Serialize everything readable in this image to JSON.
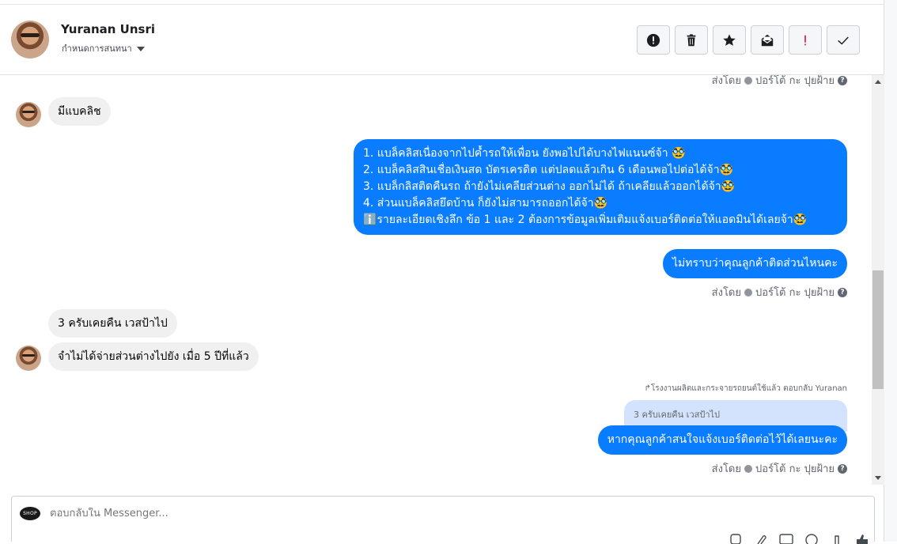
{
  "header": {
    "contact_name": "Yuranan Unsri",
    "assign_label": "กำหนดการสนทนา",
    "actions": [
      {
        "name": "follow-up-button",
        "icon": "exclamation-circle-icon"
      },
      {
        "name": "delete-button",
        "icon": "trash-icon"
      },
      {
        "name": "star-button",
        "icon": "star-icon"
      },
      {
        "name": "mark-unread-button",
        "icon": "envelope-open-icon"
      },
      {
        "name": "spam-button",
        "icon": "red-exclamation-icon"
      },
      {
        "name": "done-button",
        "icon": "check-icon"
      }
    ]
  },
  "meta": {
    "sent_by_prefix": "ส่งโดย",
    "sent_by_name": "ปอร์โต้ กะ ปุยฝ้าย",
    "help_glyph": "?"
  },
  "messages": {
    "in1": "มีแบคลิช",
    "out_long": [
      "1. แบล็คลิสเนื่องจากไปค้ำรถให้เพื่อน ยังพอไปได้บางไฟแนนซ์จ้า 🥸",
      "2. แบล็คลิสสินเชื่อเงินสด บัตรเครดิต แต่ปลดแล้วเกิน 6 เดือนพอไปต่อได้จ้า🥸",
      "3. แบล็กลิสติดคืนรถ ถ้ายังไม่เคลียส่วนต่าง ออกไม่ได้ ถ้าเคลียแล้วออกได้จ้า🥸",
      "4. ส่วนแบล็คลิสยึดบ้าน ก็ยังไม่สามารถออกได้จ้า🥸",
      "ℹ️รายละเอียดเชิงลึก ข้อ 1 และ 2 ต้องการข้อมูลเพิ่มเติมแจ้งเบอร์ติดต่อให้แอดมินได้เลยจ้า🥸"
    ],
    "out_question": "ไม่ทราบว่าคุณลูกค้าติดส่วนไหนคะ",
    "in2": "3 ครับเคยคืน เวสป้าไป",
    "in3": "จำไม่ได้จ่ายส่วนต่างไปยัง เมื่อ 5 ปีที่แล้ว",
    "reply_line": "↱โรงงานผลิตและกระจายรถยนต์ใช้แล้ว ตอบกลับ Yuranan",
    "quoted": "3 ครับเคยคืน เวสป้าไป",
    "out_final": "หากคุณลูกค้าสนใจแจ้งเบอร์ติดต่อไว้ได้เลยนะคะ"
  },
  "composer": {
    "placeholder": "ตอบกลับใน Messenger...",
    "logo_text": "SHOP",
    "tools": [
      "sticker-icon",
      "attach-icon",
      "gif-icon",
      "emoji-icon",
      "saved-reply-icon",
      "thumbs-up-icon"
    ]
  },
  "colors": {
    "accent": "#0a7cff",
    "incoming_bg": "#f0f0f0",
    "quoted_bg": "#d3e3fd",
    "spam_red": "#e0245e"
  }
}
